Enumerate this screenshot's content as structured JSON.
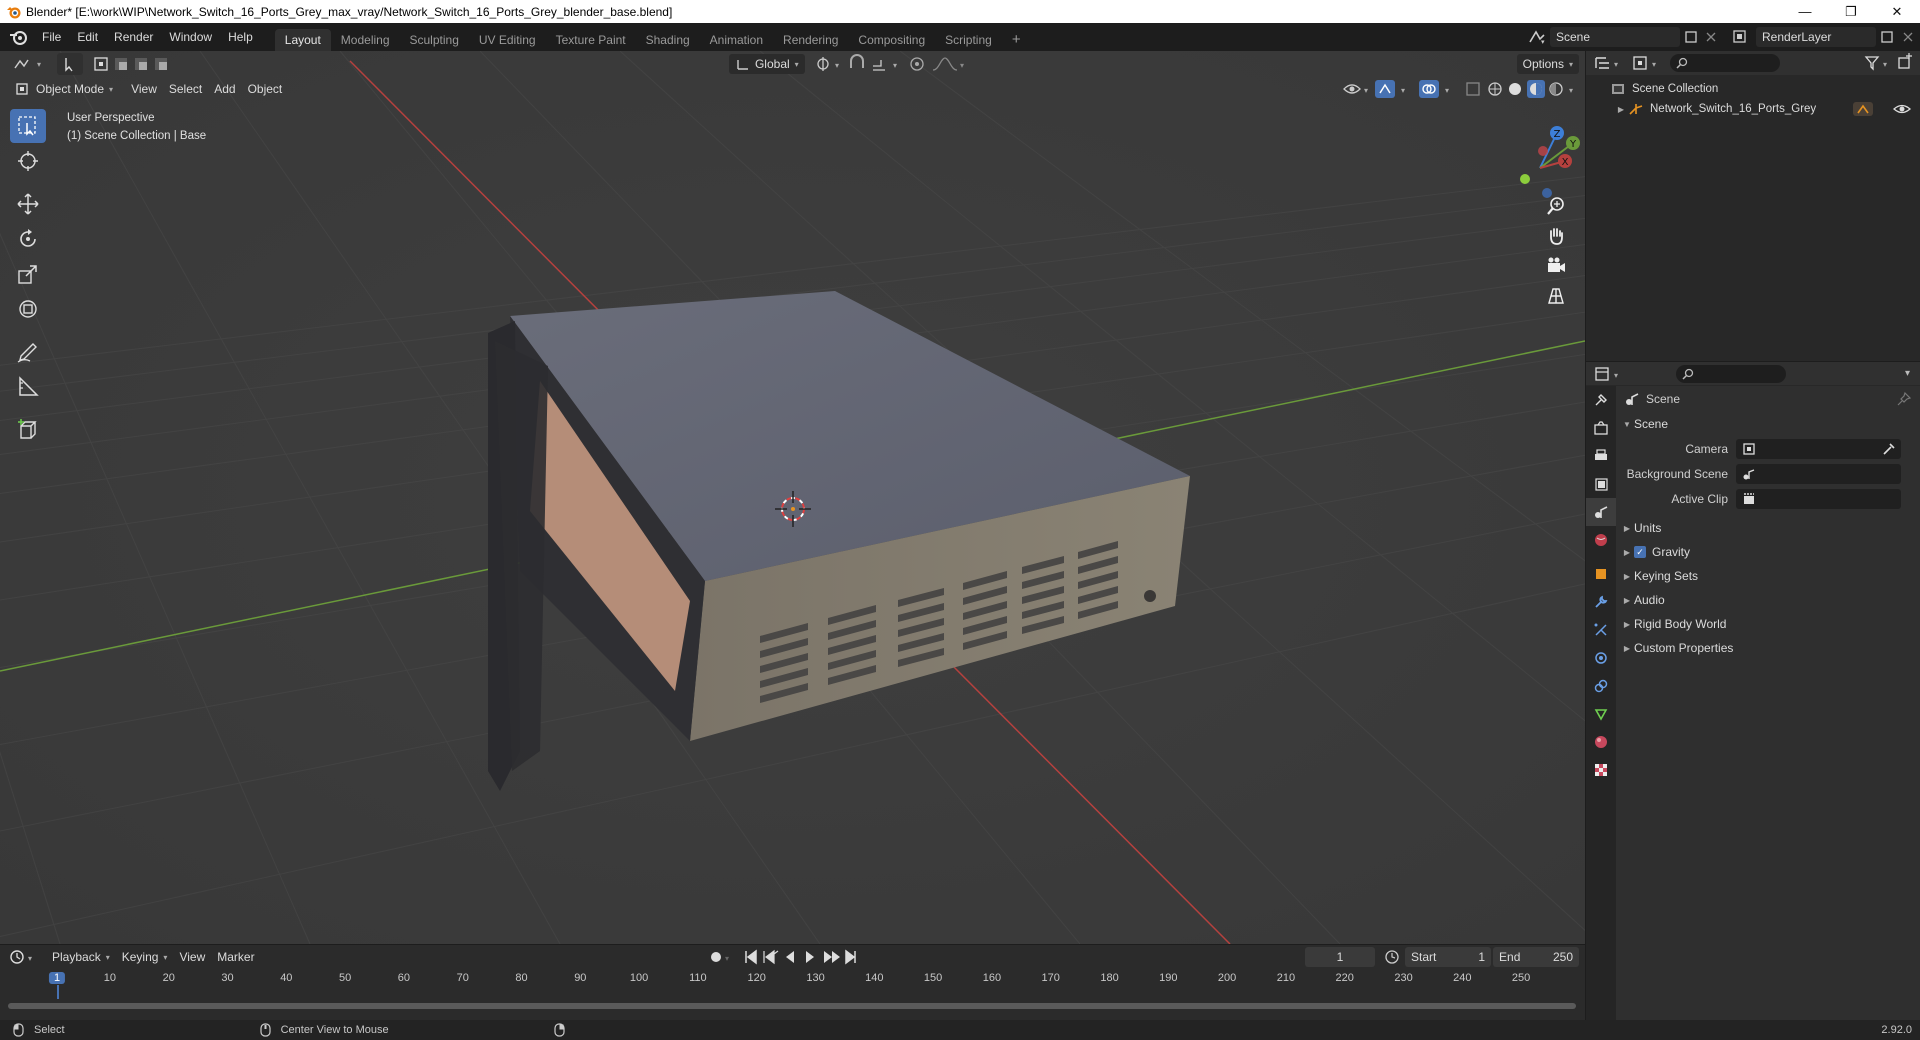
{
  "window": {
    "title": "Blender* [E:\\work\\WIP\\Network_Switch_16_Ports_Grey_max_vray/Network_Switch_16_Ports_Grey_blender_base.blend]",
    "minimize": "—",
    "restore": "❐",
    "close": "✕"
  },
  "menu": [
    "File",
    "Edit",
    "Render",
    "Window",
    "Help"
  ],
  "workspaces": [
    "Layout",
    "Modeling",
    "Sculpting",
    "UV Editing",
    "Texture Paint",
    "Shading",
    "Animation",
    "Rendering",
    "Compositing",
    "Scripting"
  ],
  "active_workspace": "Layout",
  "add_workspace": "+",
  "scene_name": "Scene",
  "render_layer": "RenderLayer",
  "viewport": {
    "mode": "Object Mode",
    "menus": [
      "View",
      "Select",
      "Add",
      "Object"
    ],
    "orientation": "Global",
    "options": "Options",
    "overlay_line1": "User Perspective",
    "overlay_line2": "(1) Scene Collection | Base",
    "gizmo_labels": {
      "x": "X",
      "y": "Y",
      "z": "Z"
    }
  },
  "outliner": {
    "root": "Scene Collection",
    "object": "Network_Switch_16_Ports_Grey"
  },
  "properties": {
    "context": "Scene",
    "panel_title": "Scene",
    "camera_label": "Camera",
    "background_label": "Background Scene",
    "clip_label": "Active Clip",
    "panels": [
      "Units",
      "Gravity",
      "Keying Sets",
      "Audio",
      "Rigid Body World",
      "Custom Properties"
    ],
    "gravity_checked": true
  },
  "timeline": {
    "menus": [
      "Playback",
      "Keying",
      "View",
      "Marker"
    ],
    "current_frame": "1",
    "start_label": "Start",
    "start": "1",
    "end_label": "End",
    "end": "250",
    "ruler": [
      "1",
      "10",
      "20",
      "30",
      "40",
      "50",
      "60",
      "70",
      "80",
      "90",
      "100",
      "110",
      "120",
      "130",
      "140",
      "150",
      "160",
      "170",
      "180",
      "190",
      "200",
      "210",
      "220",
      "230",
      "240",
      "250"
    ]
  },
  "status": {
    "left": "Select",
    "middle": "Center View to Mouse",
    "version": "2.92.0"
  },
  "colors": {
    "accent": "#4772b3",
    "x_axis": "#b5413e",
    "y_axis": "#6a9a3a",
    "z_axis": "#3d7fd8"
  }
}
